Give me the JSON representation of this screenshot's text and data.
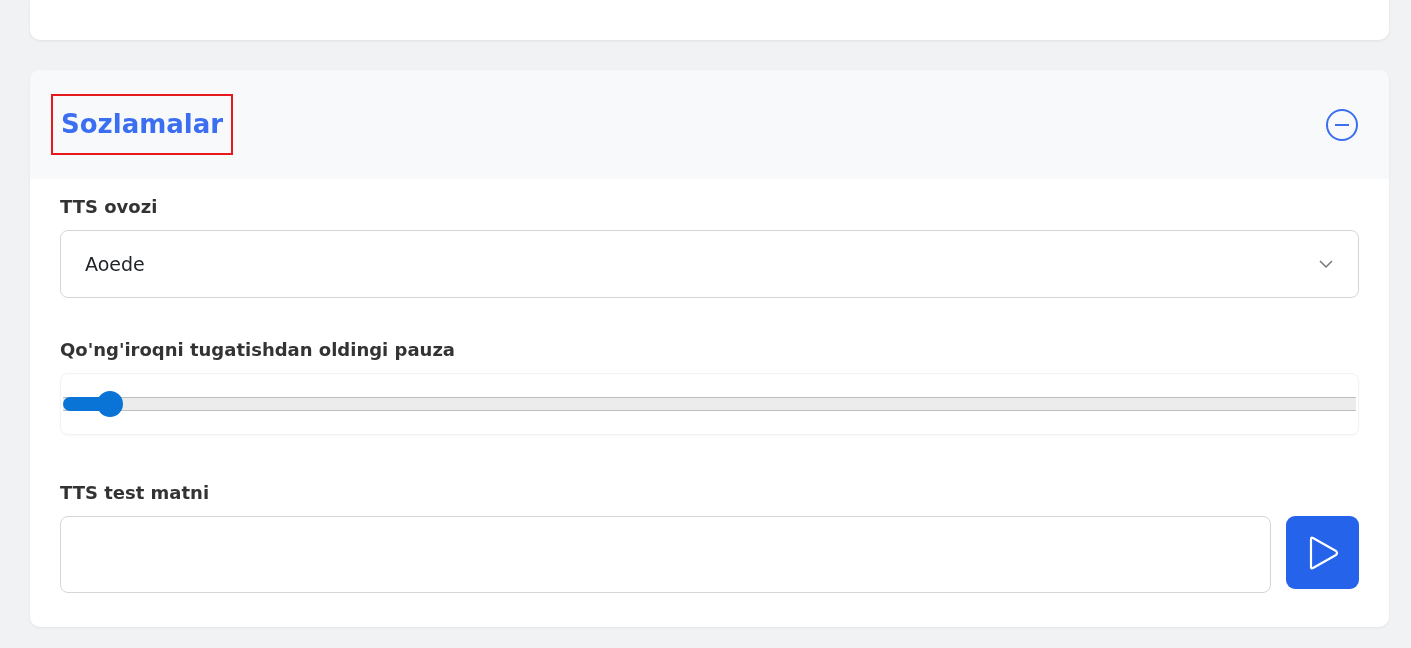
{
  "section": {
    "title": "Sozlamalar",
    "highlighted": true,
    "expanded": true
  },
  "fields": [
    {
      "kind": "select",
      "label": "TTS ovozi",
      "value": "Aoede"
    },
    {
      "kind": "slider",
      "label": "Qo'ng'iroqni tugatishdan oldingi pauza",
      "level": 0.027
    },
    {
      "kind": "text",
      "label": "TTS test matni"
    }
  ]
}
